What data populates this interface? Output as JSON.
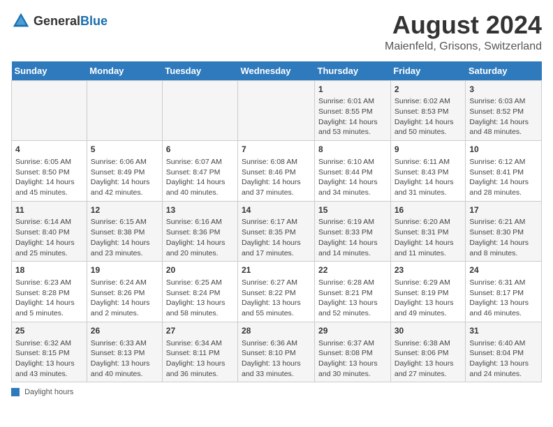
{
  "logo": {
    "general": "General",
    "blue": "Blue"
  },
  "title": "August 2024",
  "subtitle": "Maienfeld, Grisons, Switzerland",
  "days_of_week": [
    "Sunday",
    "Monday",
    "Tuesday",
    "Wednesday",
    "Thursday",
    "Friday",
    "Saturday"
  ],
  "footer_label": "Daylight hours",
  "weeks": [
    [
      {
        "day": "",
        "info": ""
      },
      {
        "day": "",
        "info": ""
      },
      {
        "day": "",
        "info": ""
      },
      {
        "day": "",
        "info": ""
      },
      {
        "day": "1",
        "info": "Sunrise: 6:01 AM\nSunset: 8:55 PM\nDaylight: 14 hours and 53 minutes."
      },
      {
        "day": "2",
        "info": "Sunrise: 6:02 AM\nSunset: 8:53 PM\nDaylight: 14 hours and 50 minutes."
      },
      {
        "day": "3",
        "info": "Sunrise: 6:03 AM\nSunset: 8:52 PM\nDaylight: 14 hours and 48 minutes."
      }
    ],
    [
      {
        "day": "4",
        "info": "Sunrise: 6:05 AM\nSunset: 8:50 PM\nDaylight: 14 hours and 45 minutes."
      },
      {
        "day": "5",
        "info": "Sunrise: 6:06 AM\nSunset: 8:49 PM\nDaylight: 14 hours and 42 minutes."
      },
      {
        "day": "6",
        "info": "Sunrise: 6:07 AM\nSunset: 8:47 PM\nDaylight: 14 hours and 40 minutes."
      },
      {
        "day": "7",
        "info": "Sunrise: 6:08 AM\nSunset: 8:46 PM\nDaylight: 14 hours and 37 minutes."
      },
      {
        "day": "8",
        "info": "Sunrise: 6:10 AM\nSunset: 8:44 PM\nDaylight: 14 hours and 34 minutes."
      },
      {
        "day": "9",
        "info": "Sunrise: 6:11 AM\nSunset: 8:43 PM\nDaylight: 14 hours and 31 minutes."
      },
      {
        "day": "10",
        "info": "Sunrise: 6:12 AM\nSunset: 8:41 PM\nDaylight: 14 hours and 28 minutes."
      }
    ],
    [
      {
        "day": "11",
        "info": "Sunrise: 6:14 AM\nSunset: 8:40 PM\nDaylight: 14 hours and 25 minutes."
      },
      {
        "day": "12",
        "info": "Sunrise: 6:15 AM\nSunset: 8:38 PM\nDaylight: 14 hours and 23 minutes."
      },
      {
        "day": "13",
        "info": "Sunrise: 6:16 AM\nSunset: 8:36 PM\nDaylight: 14 hours and 20 minutes."
      },
      {
        "day": "14",
        "info": "Sunrise: 6:17 AM\nSunset: 8:35 PM\nDaylight: 14 hours and 17 minutes."
      },
      {
        "day": "15",
        "info": "Sunrise: 6:19 AM\nSunset: 8:33 PM\nDaylight: 14 hours and 14 minutes."
      },
      {
        "day": "16",
        "info": "Sunrise: 6:20 AM\nSunset: 8:31 PM\nDaylight: 14 hours and 11 minutes."
      },
      {
        "day": "17",
        "info": "Sunrise: 6:21 AM\nSunset: 8:30 PM\nDaylight: 14 hours and 8 minutes."
      }
    ],
    [
      {
        "day": "18",
        "info": "Sunrise: 6:23 AM\nSunset: 8:28 PM\nDaylight: 14 hours and 5 minutes."
      },
      {
        "day": "19",
        "info": "Sunrise: 6:24 AM\nSunset: 8:26 PM\nDaylight: 14 hours and 2 minutes."
      },
      {
        "day": "20",
        "info": "Sunrise: 6:25 AM\nSunset: 8:24 PM\nDaylight: 13 hours and 58 minutes."
      },
      {
        "day": "21",
        "info": "Sunrise: 6:27 AM\nSunset: 8:22 PM\nDaylight: 13 hours and 55 minutes."
      },
      {
        "day": "22",
        "info": "Sunrise: 6:28 AM\nSunset: 8:21 PM\nDaylight: 13 hours and 52 minutes."
      },
      {
        "day": "23",
        "info": "Sunrise: 6:29 AM\nSunset: 8:19 PM\nDaylight: 13 hours and 49 minutes."
      },
      {
        "day": "24",
        "info": "Sunrise: 6:31 AM\nSunset: 8:17 PM\nDaylight: 13 hours and 46 minutes."
      }
    ],
    [
      {
        "day": "25",
        "info": "Sunrise: 6:32 AM\nSunset: 8:15 PM\nDaylight: 13 hours and 43 minutes."
      },
      {
        "day": "26",
        "info": "Sunrise: 6:33 AM\nSunset: 8:13 PM\nDaylight: 13 hours and 40 minutes."
      },
      {
        "day": "27",
        "info": "Sunrise: 6:34 AM\nSunset: 8:11 PM\nDaylight: 13 hours and 36 minutes."
      },
      {
        "day": "28",
        "info": "Sunrise: 6:36 AM\nSunset: 8:10 PM\nDaylight: 13 hours and 33 minutes."
      },
      {
        "day": "29",
        "info": "Sunrise: 6:37 AM\nSunset: 8:08 PM\nDaylight: 13 hours and 30 minutes."
      },
      {
        "day": "30",
        "info": "Sunrise: 6:38 AM\nSunset: 8:06 PM\nDaylight: 13 hours and 27 minutes."
      },
      {
        "day": "31",
        "info": "Sunrise: 6:40 AM\nSunset: 8:04 PM\nDaylight: 13 hours and 24 minutes."
      }
    ]
  ]
}
